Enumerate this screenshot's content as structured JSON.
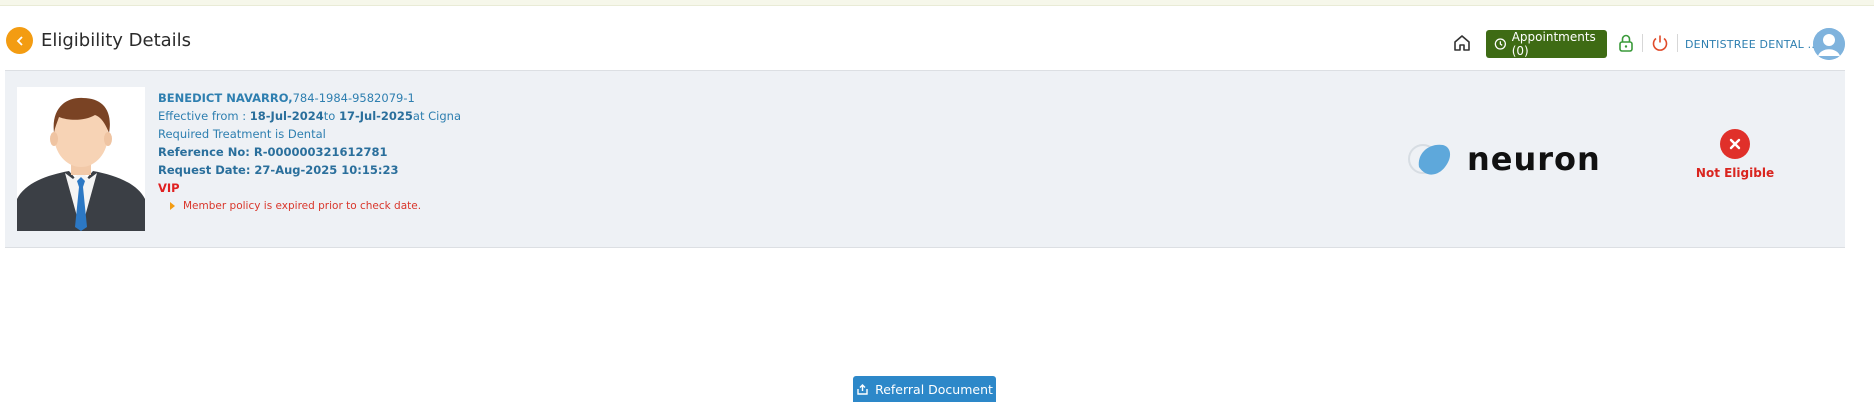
{
  "header": {
    "title": "Eligibility Details",
    "appointments_label": "Appointments (0)",
    "clinic_name": "DENTISTREE DENTAL ..."
  },
  "member": {
    "name": "BENEDICT NAVARRO,",
    "id": "784-1984-9582079-1",
    "effective_prefix": "Effective from : ",
    "effective_from": "18-Jul-2024",
    "effective_to_word": "to ",
    "effective_to": "17-Jul-2025",
    "insurer_text": "at Cigna",
    "required_treatment": "Required Treatment is Dental",
    "reference": "Reference No: R-000000321612781",
    "request_date": "Request Date: 27-Aug-2025 10:15:23",
    "tag": "VIP",
    "warning": "Member policy is expired prior to check date."
  },
  "provider_logo_text": "neuron",
  "status": {
    "label": "Not Eligible",
    "color": "#e0302a"
  },
  "actions": {
    "referral_label": "Referral Document"
  },
  "colors": {
    "accent_orange": "#f39c12",
    "appointments_green": "#3e6b14",
    "link_blue": "#2e7fb0",
    "button_blue": "#2d88c9"
  },
  "icons": {
    "back": "chevron-left-icon",
    "home": "home-icon",
    "appointments": "calendar-icon",
    "lock": "lock-icon",
    "power": "power-icon",
    "avatar": "user-avatar-icon",
    "status": "x-circle-icon",
    "referral": "upload-icon"
  }
}
